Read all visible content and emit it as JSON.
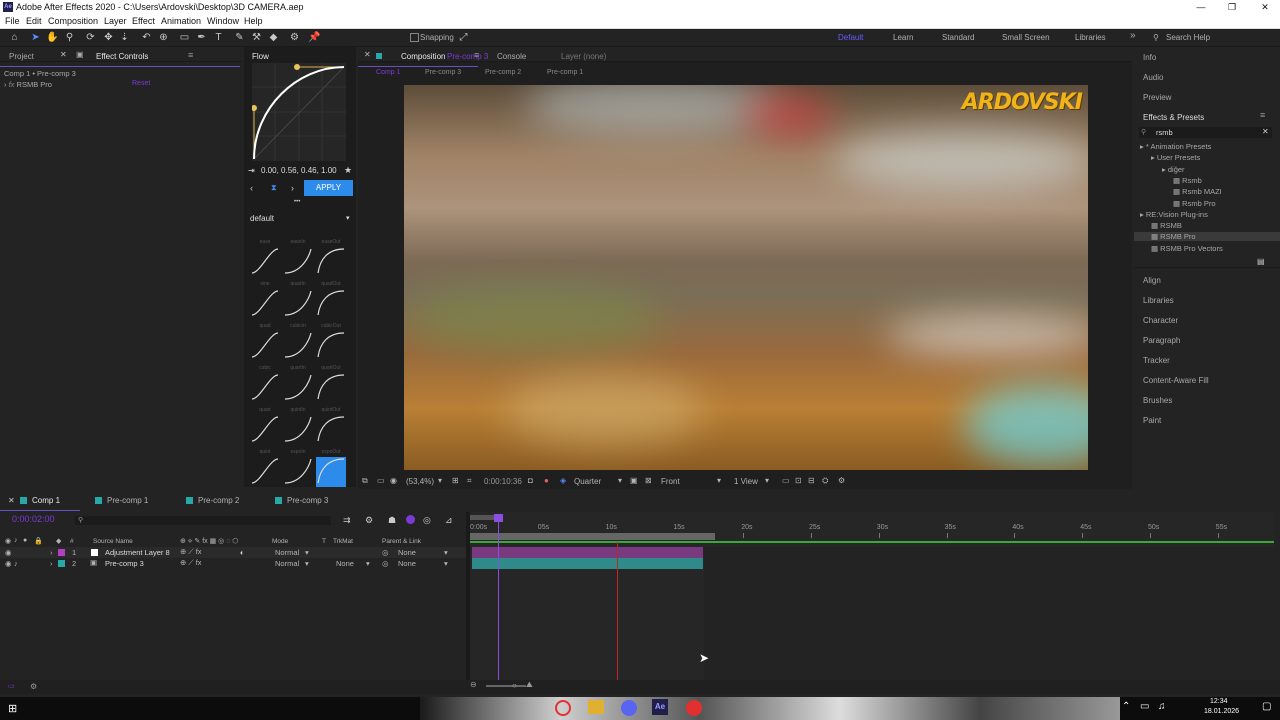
{
  "window": {
    "title": "Adobe After Effects 2020 - C:\\Users\\Ardovski\\Desktop\\3D CAMERA.aep",
    "app_badge": "Ae",
    "controls": [
      "—",
      "❐",
      "✕"
    ]
  },
  "menu": [
    "File",
    "Edit",
    "Composition",
    "Layer",
    "Effect",
    "Animation",
    "Window",
    "Help"
  ],
  "toolbar": {
    "snapping_label": "Snapping",
    "workspaces": [
      "Default",
      "Learn",
      "Standard",
      "Small Screen",
      "Libraries"
    ],
    "active_workspace": "Default",
    "search_help": "Search Help",
    "overflow": "»"
  },
  "left_panel": {
    "tabs": [
      "Project",
      "Effect Controls"
    ],
    "active_tab": "Effect Controls",
    "breadcrumb": "Comp 1 • Pre-comp 3",
    "effect": "RSMB Pro",
    "effect_prefix": "fx",
    "reset_label": "Reset"
  },
  "flow": {
    "title": "Flow",
    "bezier": "0.00, 0.56, 0.46, 1.00",
    "apply": "APPLY",
    "preset_group": "default",
    "dots": "•••",
    "presets": [
      [
        "ease",
        "easeIn",
        "easeOut"
      ],
      [
        "sine",
        "quadIn",
        "quadOut"
      ],
      [
        "quad",
        "cubicIn",
        "cubicOut"
      ],
      [
        "cubic",
        "quartIn",
        "quartOut"
      ],
      [
        "quart",
        "quintIn",
        "quintOut"
      ],
      [
        "quint",
        "expoIn",
        "expoOut"
      ]
    ]
  },
  "composition": {
    "tabs": [
      "Composition",
      "Console",
      "Layer (none)"
    ],
    "comp_name": "Pre-comp 3",
    "breadcrumbs": [
      "Comp 1",
      "Pre-comp 3",
      "Pre-comp 2",
      "Pre-comp 1"
    ],
    "watermark": "ARDOVSKI",
    "footer": {
      "zoom": "(53,4%)",
      "timecode": "0:00:10:36",
      "resolution": "Quarter",
      "view": "Front",
      "views": "1 View"
    }
  },
  "right_panel": {
    "top_items": [
      "Info",
      "Audio",
      "Preview"
    ],
    "effects_presets_title": "Effects & Presets",
    "search_value": "rsmb",
    "tree": [
      {
        "label": "* Animation Presets",
        "depth": 0,
        "type": "folder-open"
      },
      {
        "label": "User Presets",
        "depth": 1,
        "type": "folder"
      },
      {
        "label": "diğer",
        "depth": 2,
        "type": "folder"
      },
      {
        "label": "Rsmb",
        "depth": 3,
        "type": "preset"
      },
      {
        "label": "Rsmb MAZI",
        "depth": 3,
        "type": "preset"
      },
      {
        "label": "Rsmb Pro",
        "depth": 3,
        "type": "preset"
      },
      {
        "label": "RE:Vision Plug-ins",
        "depth": 0,
        "type": "folder-open"
      },
      {
        "label": "RSMB",
        "depth": 1,
        "type": "effect"
      },
      {
        "label": "RSMB Pro",
        "depth": 1,
        "type": "effect",
        "selected": true
      },
      {
        "label": "RSMB Pro Vectors",
        "depth": 1,
        "type": "effect"
      }
    ],
    "bottom_items": [
      "Align",
      "Libraries",
      "Character",
      "Paragraph",
      "Tracker",
      "Content-Aware Fill",
      "Brushes",
      "Paint"
    ]
  },
  "timeline": {
    "tabs": [
      {
        "label": "Comp 1",
        "color": "#29a8a8",
        "active": true
      },
      {
        "label": "Pre-comp 1",
        "color": "#29a8a8"
      },
      {
        "label": "Pre-comp 2",
        "color": "#29a8a8"
      },
      {
        "label": "Pre-comp 3",
        "color": "#29a8a8"
      }
    ],
    "current_time": "0:00:02:00",
    "headers": [
      "#",
      "Source Name",
      "Mode",
      "T",
      "TrkMat",
      "Parent & Link"
    ],
    "layers": [
      {
        "index": "1",
        "name": "Adjustment Layer 8",
        "mode": "Normal",
        "trkmat": "",
        "parent": "None",
        "color": "#b040c0"
      },
      {
        "index": "2",
        "name": "Pre-comp 3",
        "mode": "Normal",
        "trkmat": "None",
        "parent": "None",
        "color": "#29a8a8"
      }
    ],
    "ruler": [
      "0:00s",
      "05s",
      "10s",
      "15s",
      "20s",
      "25s",
      "30s",
      "35s",
      "40s",
      "45s",
      "50s",
      "55s"
    ],
    "colors": {
      "playhead": "#8a4ee0",
      "adjustment_bar": "#7a3a80",
      "precomp_bar": "#2f8a8a",
      "work_area": "#3aa93a"
    }
  },
  "taskbar": {
    "date": "18.01.2026",
    "time": "12:34"
  }
}
